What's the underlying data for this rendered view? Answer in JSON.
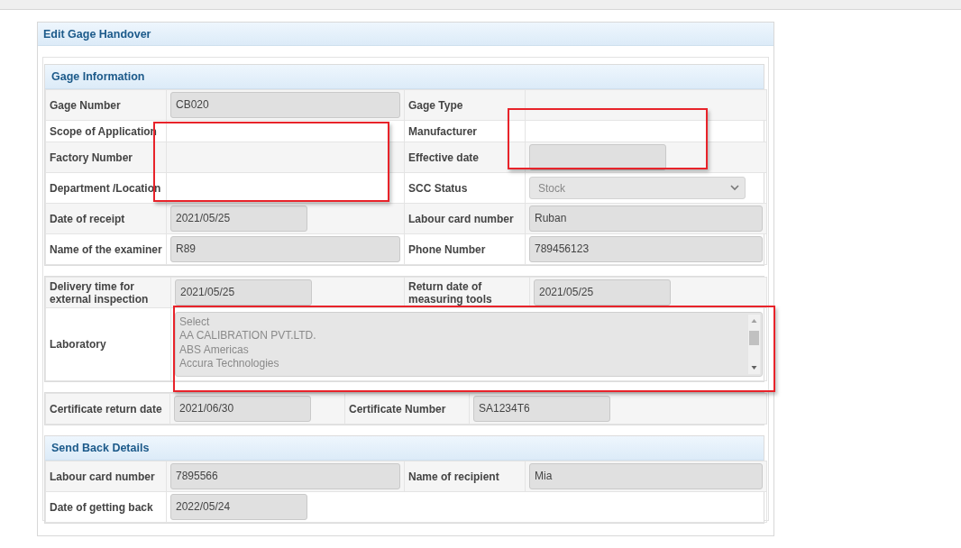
{
  "title": "Edit Gage Handover",
  "gage_information": {
    "heading": "Gage Information",
    "rows": [
      {
        "cells": [
          {
            "kind": "label",
            "text": "Gage Number"
          },
          {
            "kind": "input-wide",
            "value": "CB020"
          },
          {
            "kind": "label",
            "text": "Gage Type"
          },
          {
            "kind": "blank"
          }
        ]
      },
      {
        "cells": [
          {
            "kind": "label",
            "text": "Scope of Application"
          },
          {
            "kind": "blank"
          },
          {
            "kind": "label",
            "text": "Manufacturer"
          },
          {
            "kind": "blank"
          }
        ]
      },
      {
        "cells": [
          {
            "kind": "label",
            "text": "Factory Number"
          },
          {
            "kind": "blank"
          },
          {
            "kind": "label",
            "text": "Effective date"
          },
          {
            "kind": "input-short"
          }
        ]
      },
      {
        "cells": [
          {
            "kind": "label",
            "text": "Department /Location"
          },
          {
            "kind": "blank"
          },
          {
            "kind": "label",
            "text": "SCC Status"
          },
          {
            "kind": "select",
            "value": "Stock",
            "disabled": true
          }
        ]
      },
      {
        "cells": [
          {
            "kind": "label",
            "text": "Date of receipt"
          },
          {
            "kind": "input-short",
            "value": "2021/05/25"
          },
          {
            "kind": "label",
            "text": "Labour card number"
          },
          {
            "kind": "input-wide",
            "value": "Ruban"
          }
        ]
      },
      {
        "cells": [
          {
            "kind": "label",
            "text": "Name of the examiner"
          },
          {
            "kind": "input-wide",
            "value": "R89"
          },
          {
            "kind": "label",
            "text": "Phone Number"
          },
          {
            "kind": "input-wide",
            "value": "789456123"
          }
        ]
      }
    ]
  },
  "inspection": {
    "rows": [
      {
        "cells": [
          {
            "kind": "label",
            "text": "Delivery time for external inspection"
          },
          {
            "kind": "input-short",
            "value": "2021/05/25"
          },
          {
            "kind": "label",
            "text": "Return date of measuring tools"
          },
          {
            "kind": "input-short",
            "value": "2021/05/25"
          }
        ]
      },
      {
        "cells": [
          {
            "kind": "label",
            "text": "Laboratory"
          },
          {
            "kind": "listbox",
            "colspan": 3,
            "disabled": true,
            "options": [
              "Select",
              "AA CALIBRATION PVT.LTD.",
              "ABS Americas",
              "Accura Technologies"
            ]
          }
        ]
      }
    ]
  },
  "certificate": {
    "rows": [
      {
        "cells": [
          {
            "kind": "label",
            "text": "Certificate return date"
          },
          {
            "kind": "input-short",
            "value": "2021/06/30"
          },
          {
            "kind": "label",
            "text": "Certificate Number"
          },
          {
            "kind": "input-short",
            "value": "SA1234T6"
          }
        ]
      }
    ]
  },
  "send_back_details": {
    "heading": "Send Back Details",
    "rows": [
      {
        "cells": [
          {
            "kind": "label",
            "text": "Labour card number"
          },
          {
            "kind": "input-wide",
            "value": "7895566"
          },
          {
            "kind": "label",
            "text": "Name of recipient"
          },
          {
            "kind": "input-wide",
            "value": "Mia"
          }
        ]
      },
      {
        "cells": [
          {
            "kind": "label",
            "text": "Date of getting back"
          },
          {
            "kind": "input-short",
            "colspan": 3,
            "value": "2022/05/24"
          }
        ]
      }
    ]
  },
  "annotations": [
    {
      "kind": "red-box"
    },
    {
      "kind": "red-box"
    },
    {
      "kind": "red-box"
    }
  ]
}
